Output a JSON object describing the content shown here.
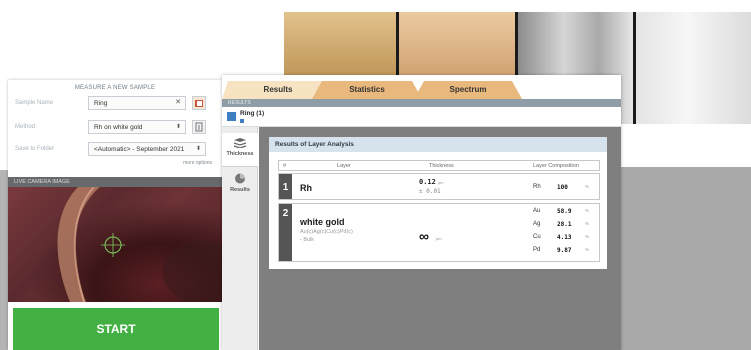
{
  "measure_panel": {
    "heading": "MEASURE A NEW SAMPLE",
    "sample_name_label": "Sample Name",
    "sample_name_value": "Ring",
    "method_label": "Method",
    "method_value": "Rh on white gold",
    "save_folder_label": "Save to Folder",
    "save_folder_value": "<Automatic> - September 2021",
    "more_options": "more options",
    "camera_label": "LIVE CAMERA IMAGE",
    "start_label": "START"
  },
  "tabs": [
    {
      "label": "Results"
    },
    {
      "label": "Statistics"
    },
    {
      "label": "Spectrum"
    }
  ],
  "results_header": "RESULTS",
  "sample_tab_label": "Ring (1)",
  "side_nav": {
    "thickness_label": "Thickness",
    "results_label": "Results"
  },
  "analysis": {
    "title": "Results of Layer Analysis",
    "columns": {
      "num": "#",
      "layer": "Layer",
      "thickness": "Thickness",
      "composition": "Layer Composition"
    },
    "layers": [
      {
        "num": "1",
        "name": "Rh",
        "thickness": "0.12",
        "unit": "µm",
        "deviation": "± 0.01",
        "composition": [
          {
            "element": "Rh",
            "value": "100",
            "unit": "%"
          }
        ]
      },
      {
        "num": "2",
        "name": "white gold",
        "formula": "Au(c)Ag(c)Cu(c)Pd(c)",
        "bulk": "- Bulk",
        "thickness": "∞",
        "unit": "µm",
        "composition": [
          {
            "element": "Au",
            "value": "58.9",
            "unit": "%"
          },
          {
            "element": "Ag",
            "value": "28.1",
            "unit": "%"
          },
          {
            "element": "Cu",
            "value": "4.13",
            "unit": "%"
          },
          {
            "element": "Pd",
            "value": "9.87",
            "unit": "%"
          }
        ]
      }
    ]
  },
  "colors": {
    "start_button": "#43b043",
    "tab_orange": "#e9b87d",
    "tab_active": "#f7e2c2",
    "card_title": "#d6e3ec"
  },
  "icons": {
    "sample_name_clear": "close-icon",
    "sample_name_browse": "folder-icon",
    "method_edit": "edit-icon",
    "thickness_nav": "layers-icon",
    "results_nav": "pie-chart-icon",
    "ring": "sample-icon"
  }
}
